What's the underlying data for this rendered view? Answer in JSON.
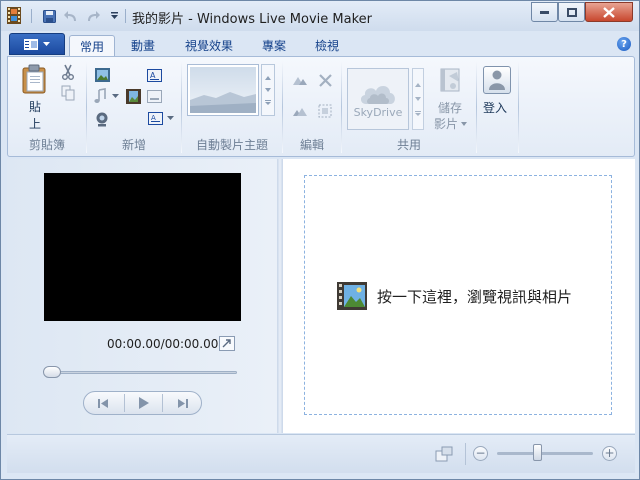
{
  "window": {
    "title": "我的影片 - Windows Live Movie Maker"
  },
  "quick_access": {
    "save_icon": "save-icon",
    "undo_icon": "undo-icon",
    "redo_icon": "redo-icon",
    "customize_icon": "chevron-down-icon"
  },
  "tabs": [
    {
      "label": "常用",
      "active": true
    },
    {
      "label": "動畫",
      "active": false
    },
    {
      "label": "視覺效果",
      "active": false
    },
    {
      "label": "專案",
      "active": false
    },
    {
      "label": "檢視",
      "active": false
    }
  ],
  "ribbon": {
    "clipboard": {
      "label": "剪貼簿",
      "paste_label_1": "貼",
      "paste_label_2": "上"
    },
    "add": {
      "label": "新增"
    },
    "auto_themes": {
      "label": "自動製片主題"
    },
    "editing": {
      "label": "編輯"
    },
    "share": {
      "label": "共用",
      "skydrive_label": "SkyDrive",
      "save_movie_label_1": "儲存",
      "save_movie_label_2": "影片"
    },
    "sign_in": {
      "label": "登入"
    }
  },
  "preview": {
    "timecode": "00:00.00/00:00.00",
    "seek_position": 0
  },
  "storyboard": {
    "browse_text": "按一下這裡，瀏覽視訊與相片"
  },
  "colors": {
    "accent": "#1c4aa0",
    "close": "#c8472e"
  }
}
